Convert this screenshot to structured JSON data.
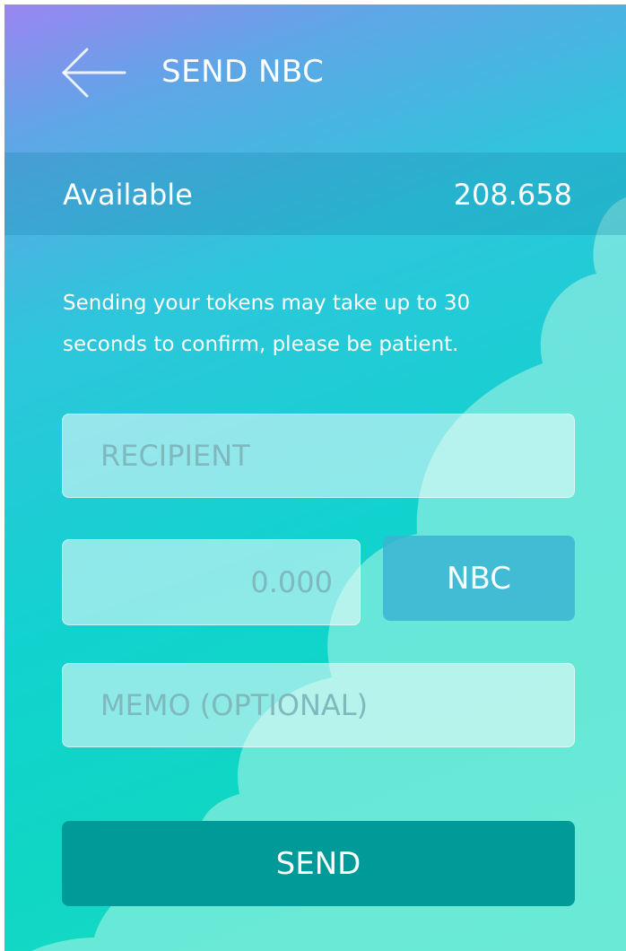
{
  "header": {
    "title": "SEND NBC",
    "back_icon": "arrow-left-icon"
  },
  "balance": {
    "label": "Available",
    "value": "208.658"
  },
  "notice": "Sending your tokens may take up to 30 seconds to confirm, please be patient.",
  "form": {
    "recipient": {
      "value": "",
      "placeholder": "RECIPIENT"
    },
    "amount": {
      "value": "",
      "placeholder": "0.000"
    },
    "currency": "NBC",
    "memo": {
      "value": "",
      "placeholder": "MEMO (OPTIONAL)"
    },
    "send_label": "SEND"
  },
  "colors": {
    "gradient_top": "#9b85f2",
    "gradient_mid": "#2ec6dc",
    "gradient_bottom": "#10d6c4",
    "send_button": "#009a98",
    "currency_button": "#3cb4d2",
    "text": "#ffffff",
    "placeholder": "#7fb8bd"
  }
}
